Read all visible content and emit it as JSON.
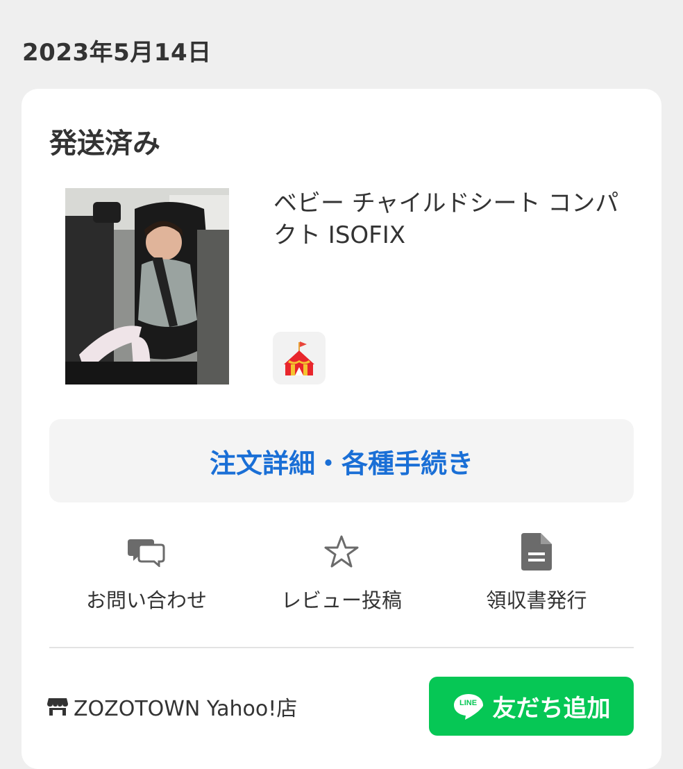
{
  "order": {
    "date": "2023年5月14日",
    "status": "発送済み"
  },
  "product": {
    "title": "ベビー チャイルドシート コンパクト ISOFIX",
    "image_icon": "car-seat-photo",
    "shop_badge_icon": "tent-icon"
  },
  "detail_button": {
    "label": "注文詳細・各種手続き"
  },
  "actions": [
    {
      "label": "お問い合わせ",
      "icon": "chat-bubbles-icon"
    },
    {
      "label": "レビュー投稿",
      "icon": "star-icon"
    },
    {
      "label": "領収書発行",
      "icon": "document-icon"
    }
  ],
  "shop": {
    "name": "ZOZOTOWN Yahoo!店",
    "icon": "store-icon"
  },
  "line_button": {
    "logo_text": "LINE",
    "label": "友だち追加"
  },
  "colors": {
    "accent_blue": "#1a6fd6",
    "line_green": "#06c755",
    "background": "#efefef"
  }
}
